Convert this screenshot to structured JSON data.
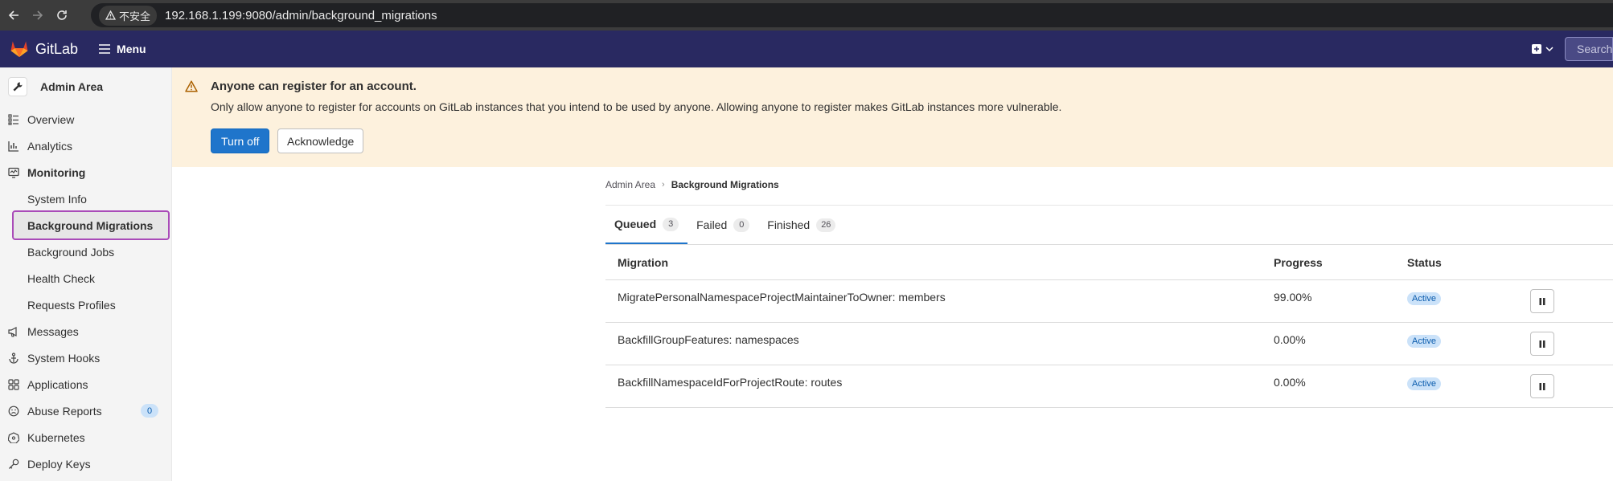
{
  "browser": {
    "insecure_label": "不安全",
    "url": "192.168.1.199:9080/admin/background_migrations"
  },
  "topbar": {
    "logo_text": "GitLab",
    "menu_label": "Menu",
    "search_placeholder": "Search"
  },
  "sidebar": {
    "header": "Admin Area",
    "items": [
      {
        "label": "Overview",
        "icon": "overview-icon"
      },
      {
        "label": "Analytics",
        "icon": "chart-icon"
      },
      {
        "label": "Monitoring",
        "icon": "monitor-icon"
      },
      {
        "label": "System Info"
      },
      {
        "label": "Background Migrations",
        "active": true
      },
      {
        "label": "Background Jobs"
      },
      {
        "label": "Health Check"
      },
      {
        "label": "Requests Profiles"
      },
      {
        "label": "Messages",
        "icon": "bullhorn-icon"
      },
      {
        "label": "System Hooks",
        "icon": "hook-icon"
      },
      {
        "label": "Applications",
        "icon": "applications-icon"
      },
      {
        "label": "Abuse Reports",
        "icon": "abuse-icon",
        "count": "0"
      },
      {
        "label": "Kubernetes",
        "icon": "kubernetes-icon"
      },
      {
        "label": "Deploy Keys",
        "icon": "key-icon"
      }
    ]
  },
  "banner": {
    "title": "Anyone can register for an account.",
    "body": "Only allow anyone to register for accounts on GitLab instances that you intend to be used by anyone. Allowing anyone to register makes GitLab instances more vulnerable.",
    "primary_button": "Turn off",
    "secondary_button": "Acknowledge"
  },
  "breadcrumb": {
    "parent": "Admin Area",
    "current": "Background Migrations"
  },
  "tabs": [
    {
      "label": "Queued",
      "count": "3"
    },
    {
      "label": "Failed",
      "count": "0"
    },
    {
      "label": "Finished",
      "count": "26"
    }
  ],
  "table": {
    "headers": {
      "migration": "Migration",
      "progress": "Progress",
      "status": "Status"
    },
    "rows": [
      {
        "migration": "MigratePersonalNamespaceProjectMaintainerToOwner: members",
        "progress": "99.00%",
        "status": "Active"
      },
      {
        "migration": "BackfillGroupFeatures: namespaces",
        "progress": "0.00%",
        "status": "Active"
      },
      {
        "migration": "BackfillNamespaceIdForProjectRoute: routes",
        "progress": "0.00%",
        "status": "Active"
      }
    ]
  }
}
